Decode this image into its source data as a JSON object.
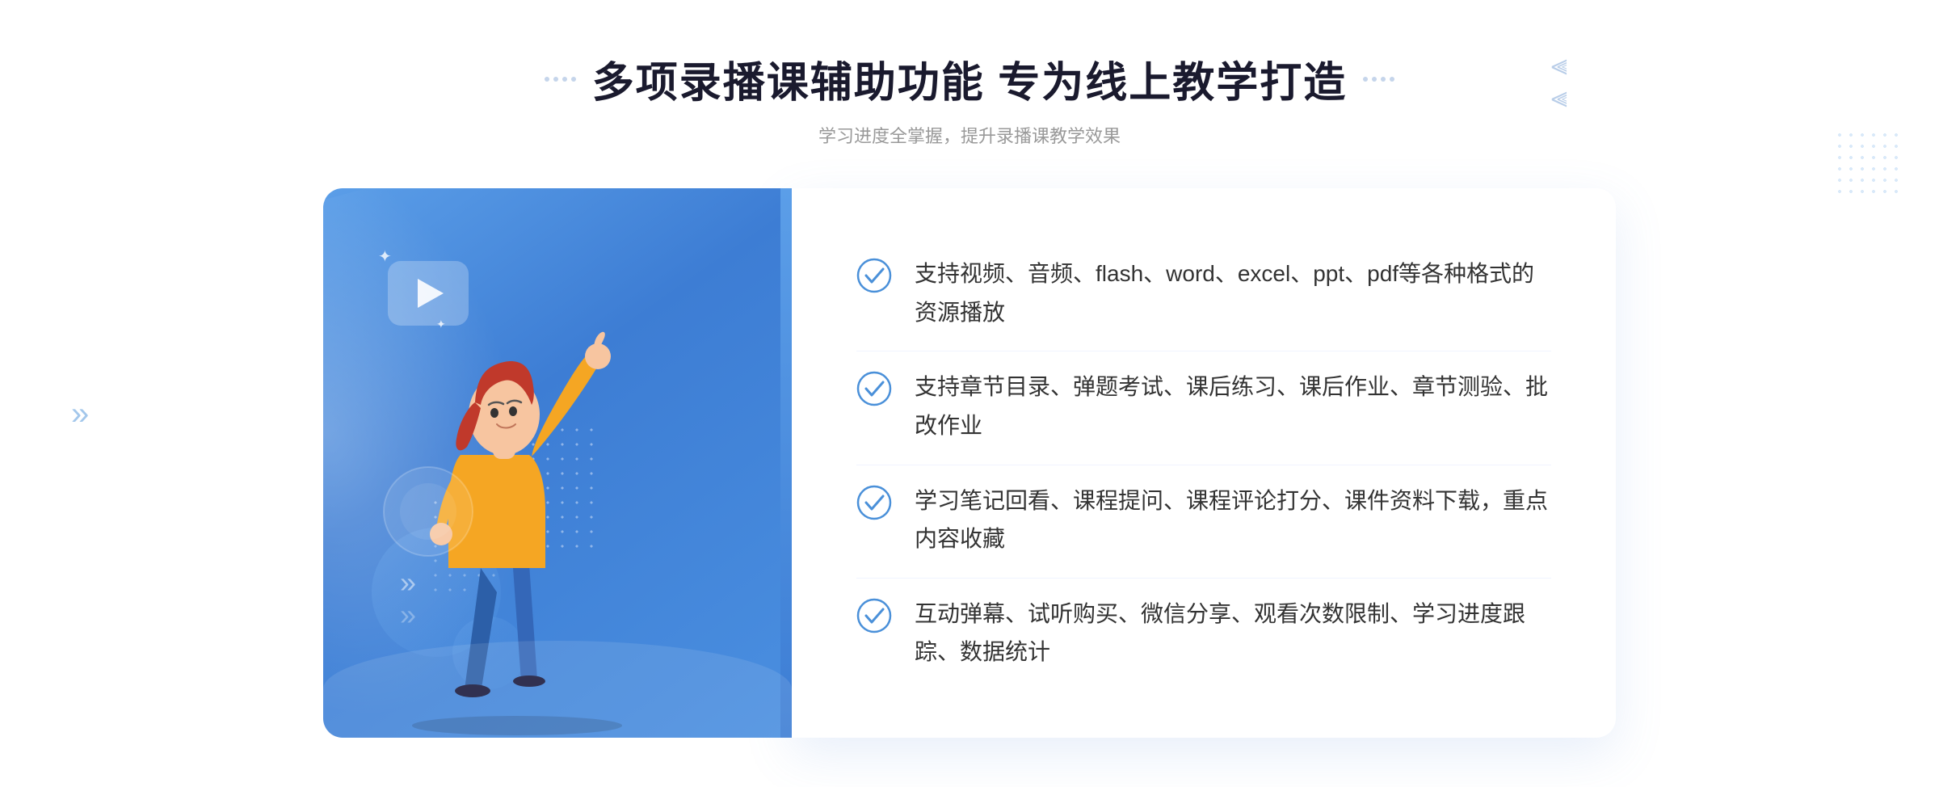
{
  "header": {
    "title": "多项录播课辅助功能 专为线上教学打造",
    "subtitle": "学习进度全掌握，提升录播课教学效果"
  },
  "features": [
    {
      "id": "feature-1",
      "text": "支持视频、音频、flash、word、excel、ppt、pdf等各种格式的资源播放"
    },
    {
      "id": "feature-2",
      "text": "支持章节目录、弹题考试、课后练习、课后作业、章节测验、批改作业"
    },
    {
      "id": "feature-3",
      "text": "学习笔记回看、课程提问、课程评论打分、课件资料下载，重点内容收藏"
    },
    {
      "id": "feature-4",
      "text": "互动弹幕、试听购买、微信分享、观看次数限制、学习进度跟踪、数据统计"
    }
  ],
  "icons": {
    "check": "check-circle-icon",
    "play": "play-icon",
    "chevron": "chevron-icon"
  },
  "colors": {
    "accent": "#4a8fe0",
    "title": "#1a1a2e",
    "text": "#333333",
    "subtitle": "#999999",
    "check": "#4a90d9"
  }
}
